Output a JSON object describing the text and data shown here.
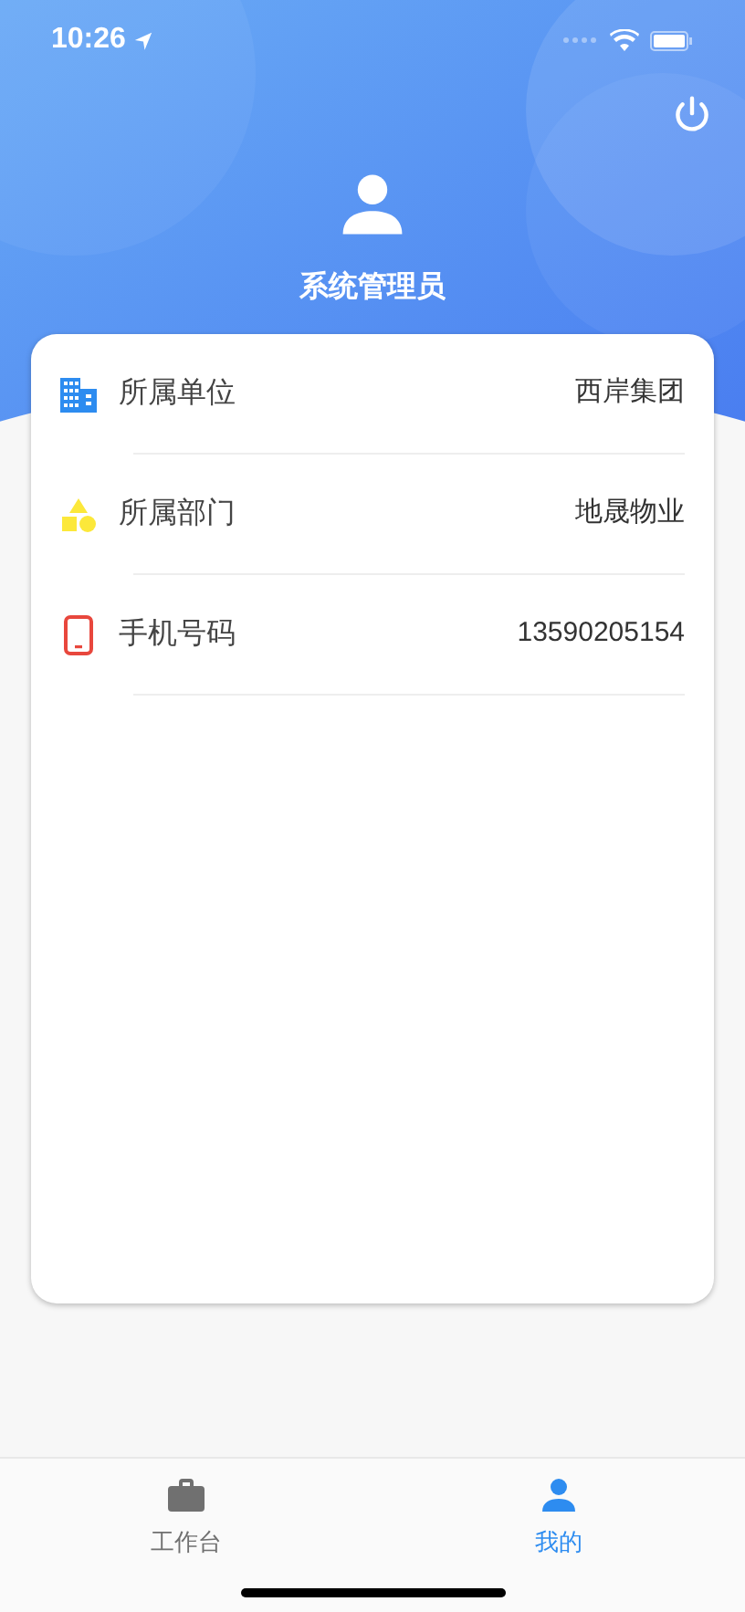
{
  "status_bar": {
    "time": "10:26"
  },
  "profile": {
    "name": "系统管理员"
  },
  "info_rows": [
    {
      "kind": "building",
      "label": "所属单位",
      "value": "西岸集团"
    },
    {
      "kind": "shapes",
      "label": "所属部门",
      "value": "地晟物业"
    },
    {
      "kind": "phone",
      "label": "手机号码",
      "value": "13590205154"
    }
  ],
  "tabs": [
    {
      "kind": "briefcase",
      "label": "工作台",
      "selected": false
    },
    {
      "kind": "person",
      "label": "我的",
      "selected": true
    }
  ]
}
